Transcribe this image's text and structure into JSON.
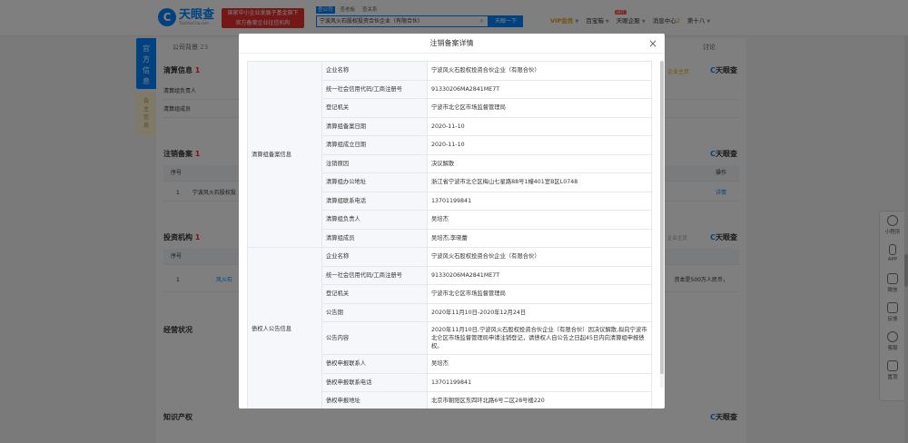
{
  "header": {
    "logo_cn": "天眼查",
    "logo_en": "TianYanCha.com",
    "banner_line1": "国家中小企业发展子基金旗下",
    "banner_line2": "官方备案企业征信机构",
    "search_tabs": [
      "查公司",
      "查老板",
      "查关系"
    ],
    "search_value": "宁波风火石股权投资合伙企业（有限合伙）",
    "search_button": "天眼一下",
    "nav_vip": "VIP会员",
    "nav_hot": "HOT",
    "nav_bao": "百宝箱",
    "nav_enterprise": "天眼企服",
    "nav_messages": "消息中心",
    "nav_msg_count": "2",
    "nav_user": "第十八"
  },
  "leftbar": {
    "official": "官方信息",
    "self": "自主信息"
  },
  "page": {
    "tab_background": "公司背景",
    "tab_background_count": "23",
    "tab_discuss": "讨论",
    "liquidation_title": "清算信息",
    "liquidation_count": "1",
    "liquidation_rows": [
      "清算组负责人",
      "清算组成员"
    ],
    "liquidation_source": "企业主页",
    "brand": "天眼查",
    "cancel_title": "注销备案",
    "cancel_count": "1",
    "cancel_header_no": "序号",
    "cancel_header_op": "操作",
    "cancel_row_no": "1",
    "cancel_row_name": "宁波风火石股权投",
    "cancel_row_op": "详情",
    "invest_title": "投资机构",
    "invest_count": "1",
    "invest_source": "企业主页",
    "invest_header_no": "序号",
    "invest_row_no": "1",
    "invest_row_name": "风火石",
    "invest_row_tail": "资本是500万人民币，",
    "ops_title": "经营状况",
    "ip_title": "知识产权"
  },
  "rightbar": [
    "小程序",
    "APP",
    "微信",
    "反馈",
    "客服",
    "置顶"
  ],
  "modal": {
    "title": "注销备案详情",
    "group1": "清算组备案信息",
    "group2": "债权人公告信息",
    "rows1": [
      {
        "label": "企业名称",
        "value": "宁波风火石股权投资合伙企业（有限合伙）"
      },
      {
        "label": "统一社会信用代码/工商注册号",
        "value": "91330206MA2841ME7T"
      },
      {
        "label": "登记机关",
        "value": "宁波市北仑区市场监督管理局"
      },
      {
        "label": "清算组备案日期",
        "value": "2020-11-10"
      },
      {
        "label": "清算组成立日期",
        "value": "2020-11-10"
      },
      {
        "label": "注销原因",
        "value": "决议解散"
      },
      {
        "label": "清算组办公地址",
        "value": "浙江省宁波市北仑区梅山七星路88号1幢401室B区L0748"
      },
      {
        "label": "清算组联系电话",
        "value": "13701199841"
      },
      {
        "label": "清算组负责人",
        "value": "吴培杰"
      },
      {
        "label": "清算组成员",
        "value": "吴培杰,李晓蕾"
      }
    ],
    "rows2": [
      {
        "label": "企业名称",
        "value": "宁波风火石股权投资合伙企业（有限合伙）"
      },
      {
        "label": "统一社会信用代码/工商注册号",
        "value": "91330206MA2841ME7T"
      },
      {
        "label": "登记机关",
        "value": "宁波市北仑区市场监督管理局"
      },
      {
        "label": "公告期",
        "value": "2020年11月10日-2020年12月24日"
      },
      {
        "label": "公告内容",
        "value": "2020年11月10日,宁波风火石股权投资合伙企业（有限合伙）因决议解散,拟向宁波市北仑区市场监督管理局申请注销登记，请债权人自公告之日起45日内向清算组申报债权。"
      },
      {
        "label": "债权申报联系人",
        "value": "吴培杰"
      },
      {
        "label": "债权申报联系电话",
        "value": "13701199841"
      },
      {
        "label": "债权申报地址",
        "value": "北京市朝阳区东四环北路6号二区28号楼220"
      }
    ]
  }
}
